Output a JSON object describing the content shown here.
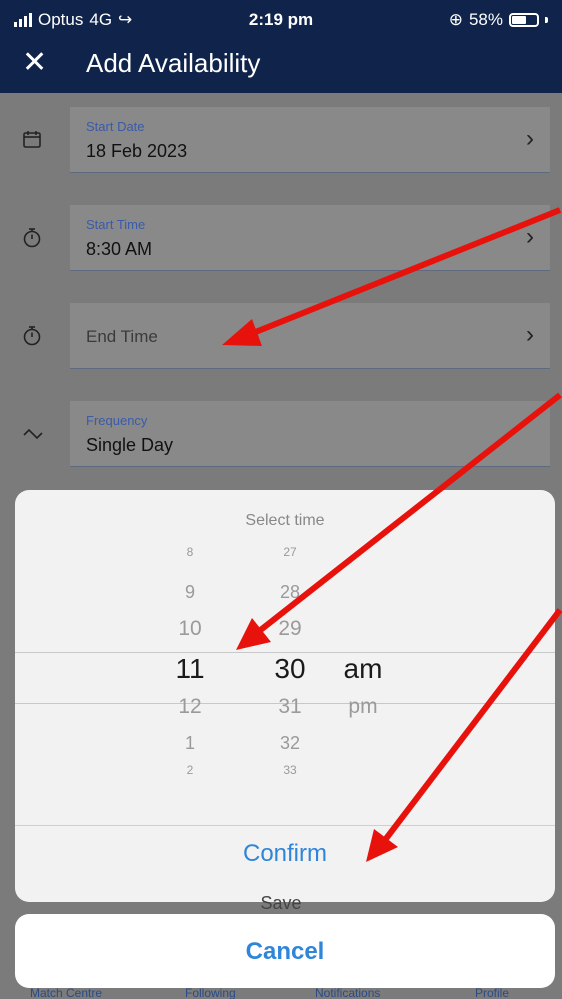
{
  "status_bar": {
    "carrier": "Optus",
    "network": "4G",
    "time": "2:19 pm",
    "battery": "58%"
  },
  "header": {
    "close_icon": "close-icon",
    "title": "Add Availability"
  },
  "form": {
    "start_date": {
      "label": "Start Date",
      "value": "18 Feb 2023",
      "icon": "calendar-icon"
    },
    "start_time": {
      "label": "Start Time",
      "value": "8:30 AM",
      "icon": "stopwatch-icon"
    },
    "end_time": {
      "placeholder": "End Time",
      "icon": "stopwatch-icon"
    },
    "frequency": {
      "label": "Frequency",
      "value": "Single Day",
      "icon": "wave-icon"
    }
  },
  "picker": {
    "title": "Select time",
    "hours": [
      "8",
      "9",
      "10",
      "11",
      "12",
      "1",
      "2"
    ],
    "minutes": [
      "27",
      "28",
      "29",
      "30",
      "31",
      "32",
      "33"
    ],
    "period": [
      "am",
      "pm"
    ],
    "selected": {
      "hour": "11",
      "minute": "30",
      "period": "am"
    },
    "confirm_label": "Confirm"
  },
  "save_label": "Save",
  "cancel_label": "Cancel",
  "tabbar": {
    "items": [
      "Match Centre",
      "Following",
      "Notifications",
      "Profile"
    ]
  },
  "colors": {
    "header_bg": "#10234a",
    "accent_blue": "#2f86d8",
    "annotation_arrow": "#e8120c"
  }
}
